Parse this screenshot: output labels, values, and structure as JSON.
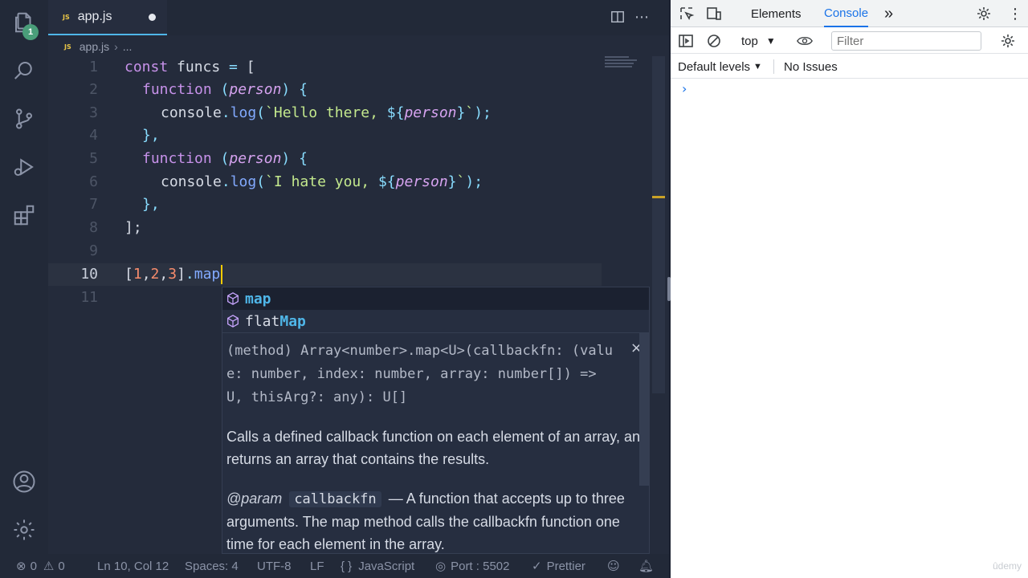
{
  "editor": {
    "tab": {
      "filename": "app.js",
      "badge": "JS",
      "unsaved": true
    },
    "breadcrumb": {
      "file": "app.js",
      "sep": "›",
      "more": "..."
    },
    "explorer_badge": "1",
    "lines": [
      {
        "num": "1"
      },
      {
        "num": "2"
      },
      {
        "num": "3"
      },
      {
        "num": "4"
      },
      {
        "num": "5"
      },
      {
        "num": "6"
      },
      {
        "num": "7"
      },
      {
        "num": "8"
      },
      {
        "num": "9"
      },
      {
        "num": "10"
      },
      {
        "num": "11"
      }
    ],
    "code": {
      "l1_kw": "const",
      "l1_name": " funcs ",
      "l1_eq": "=",
      "l1_br": " [",
      "fn_kw": "function",
      "paren_open": " (",
      "param": "person",
      "paren_close": ")",
      "brace_open": " {",
      "console": "console",
      "dot": ".",
      "log": "log",
      "lparen": "(",
      "tpl1_a": "`Hello there, ",
      "tpl_open": "${",
      "tpl_close": "}",
      "tpl_end": "`",
      "rparen_semi": ");",
      "tpl2_a": "`I hate you, ",
      "brace_close": "},",
      "arr_close": "];",
      "l10_open": "[",
      "n1": "1",
      "comma": ",",
      "n2": "2",
      "n3": "3",
      "l10_close": "]",
      "l10_dot": ".",
      "l10_map": "map"
    },
    "current_line": "10"
  },
  "suggest": {
    "items": [
      {
        "highlight": "map",
        "rest": "",
        "icon": "cube-icon"
      },
      {
        "prefix": "flat",
        "highlight": "Map",
        "icon": "cube-icon"
      }
    ],
    "signature": "(method) Array<number>.map<U>(callbackfn: (value: number, index: number, array: number[]) => U, thisArg?: any): U[]",
    "description": "Calls a defined callback function on each element of an array, and returns an array that contains the results.",
    "param_tag": "@param",
    "param_name": "callbackfn",
    "param_desc": "— A function that accepts up to three arguments. The map method calls the callbackfn function one time for each element in the array.",
    "close": "×"
  },
  "statusbar": {
    "errors": "0",
    "warnings": "0",
    "position": "Ln 10, Col 12",
    "spaces": "Spaces: 4",
    "encoding": "UTF-8",
    "eol": "LF",
    "language": "JavaScript",
    "port": "Port : 5502",
    "formatter": "Prettier"
  },
  "devtools": {
    "tabs": [
      "Elements",
      "Console"
    ],
    "active_tab": "Console",
    "more": "»",
    "context": "top",
    "filter_placeholder": "Filter",
    "levels": "Default levels",
    "issues": "No Issues",
    "prompt": "›"
  },
  "watermark": "ûdemy",
  "colors": {
    "accent": "#4fb6e8",
    "console_tab": "#1a73e8",
    "badge": "#4a9e7a"
  }
}
